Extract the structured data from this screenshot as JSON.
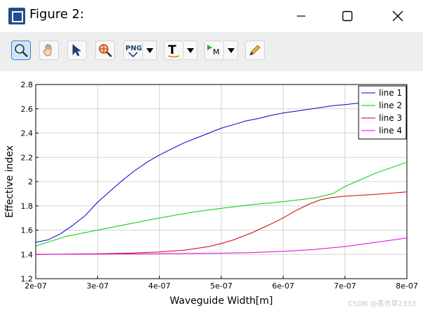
{
  "window": {
    "title": "Figure 2:"
  },
  "toolbar": {
    "tools": [
      "zoom-tool",
      "pan-tool",
      "select-arrow-tool",
      "zoom-region-tool",
      "png-export",
      "text-tool",
      "marker-tool",
      "pencil-tool"
    ],
    "png_label": "PNG",
    "text_label": "T",
    "marker_label": "M"
  },
  "watermark": "CSDN @蒸衣草2333",
  "chart_data": {
    "type": "line",
    "xlabel": "Waveguide Width[m]",
    "ylabel": "Effective index",
    "xlim": [
      2e-07,
      8e-07
    ],
    "ylim": [
      1.2,
      2.8
    ],
    "xticks": [
      2e-07,
      3e-07,
      4e-07,
      5e-07,
      6e-07,
      7e-07,
      8e-07
    ],
    "xtick_labels": [
      "2e-07",
      "3e-07",
      "4e-07",
      "5e-07",
      "6e-07",
      "7e-07",
      "8e-07"
    ],
    "yticks": [
      1.2,
      1.4,
      1.6,
      1.8,
      2,
      2.2,
      2.4,
      2.6,
      2.8
    ],
    "ytick_labels": [
      "1.2",
      "1.4",
      "1.6",
      "1.8",
      "2",
      "2.2",
      "2.4",
      "2.6",
      "2.8"
    ],
    "grid": true,
    "legend_position": "top-right",
    "series": [
      {
        "name": "line 1",
        "color": "#0000cc",
        "x": [
          2e-07,
          2.2e-07,
          2.4e-07,
          2.6e-07,
          2.8e-07,
          3e-07,
          3.2e-07,
          3.4e-07,
          3.6e-07,
          3.8e-07,
          4e-07,
          4.2e-07,
          4.4e-07,
          4.6e-07,
          4.8e-07,
          5e-07,
          5.2e-07,
          5.4e-07,
          5.6e-07,
          5.8e-07,
          6e-07,
          6.2e-07,
          6.4e-07,
          6.6e-07,
          6.8e-07,
          7e-07,
          7.2e-07,
          7.4e-07
        ],
        "y": [
          1.5,
          1.52,
          1.57,
          1.64,
          1.72,
          1.83,
          1.92,
          2.01,
          2.09,
          2.16,
          2.22,
          2.27,
          2.32,
          2.36,
          2.4,
          2.44,
          2.47,
          2.5,
          2.52,
          2.545,
          2.565,
          2.58,
          2.595,
          2.61,
          2.625,
          2.635,
          2.645,
          2.652
        ]
      },
      {
        "name": "line 2",
        "color": "#00cc00",
        "x": [
          2e-07,
          2.5e-07,
          3e-07,
          3.5e-07,
          4e-07,
          4.5e-07,
          5e-07,
          5.5e-07,
          6e-07,
          6.5e-07,
          6.8e-07,
          7e-07,
          7.5e-07,
          8e-07
        ],
        "y": [
          1.47,
          1.55,
          1.6,
          1.65,
          1.7,
          1.745,
          1.78,
          1.81,
          1.835,
          1.865,
          1.9,
          1.96,
          2.07,
          2.16
        ]
      },
      {
        "name": "line 3",
        "color": "#cc0000",
        "x": [
          2e-07,
          3e-07,
          3.5e-07,
          4e-07,
          4.4e-07,
          4.8e-07,
          5e-07,
          5.2e-07,
          5.5e-07,
          5.8e-07,
          6e-07,
          6.2e-07,
          6.4e-07,
          6.6e-07,
          6.8e-07,
          7e-07,
          7.5e-07,
          8e-07
        ],
        "y": [
          1.4,
          1.405,
          1.41,
          1.42,
          1.435,
          1.465,
          1.49,
          1.52,
          1.58,
          1.65,
          1.7,
          1.76,
          1.81,
          1.85,
          1.87,
          1.88,
          1.895,
          1.915
        ]
      },
      {
        "name": "line 4",
        "color": "#dd00dd",
        "x": [
          2e-07,
          3e-07,
          4e-07,
          5e-07,
          5.5e-07,
          6e-07,
          6.5e-07,
          7e-07,
          7.5e-07,
          8e-07
        ],
        "y": [
          1.4,
          1.403,
          1.406,
          1.41,
          1.415,
          1.425,
          1.44,
          1.465,
          1.5,
          1.535
        ]
      }
    ]
  }
}
